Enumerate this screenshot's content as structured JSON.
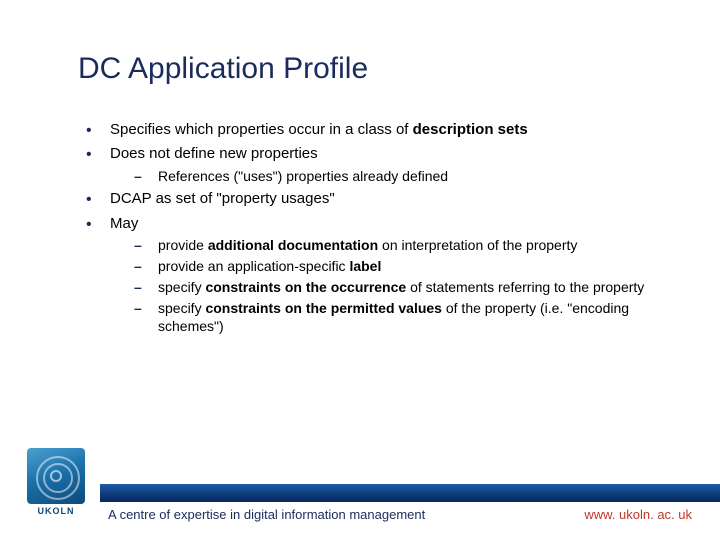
{
  "title": "DC Application Profile",
  "bullets": {
    "b1_pre": "Specifies which properties occur in a class of ",
    "b1_bold": "description sets",
    "b2": "Does not define new properties",
    "b2_sub1": "References (\"uses\") properties already defined",
    "b3": "DCAP as set of \"property usages\"",
    "b4": "May",
    "b4_sub1_pre": "provide ",
    "b4_sub1_bold": "additional documentation",
    "b4_sub1_post": " on interpretation of the property",
    "b4_sub2_pre": "provide an application-specific ",
    "b4_sub2_bold": "label",
    "b4_sub3_pre": "specify ",
    "b4_sub3_bold": "constraints on the occurrence",
    "b4_sub3_post": " of statements referring to the property",
    "b4_sub4_pre": "specify ",
    "b4_sub4_bold": "constraints on the permitted values",
    "b4_sub4_post": " of the property (i.e. \"encoding schemes\")"
  },
  "footer": {
    "tagline": "A centre of expertise in digital information management",
    "url": "www. ukoln. ac. uk",
    "logo_text": "UKOLN"
  }
}
